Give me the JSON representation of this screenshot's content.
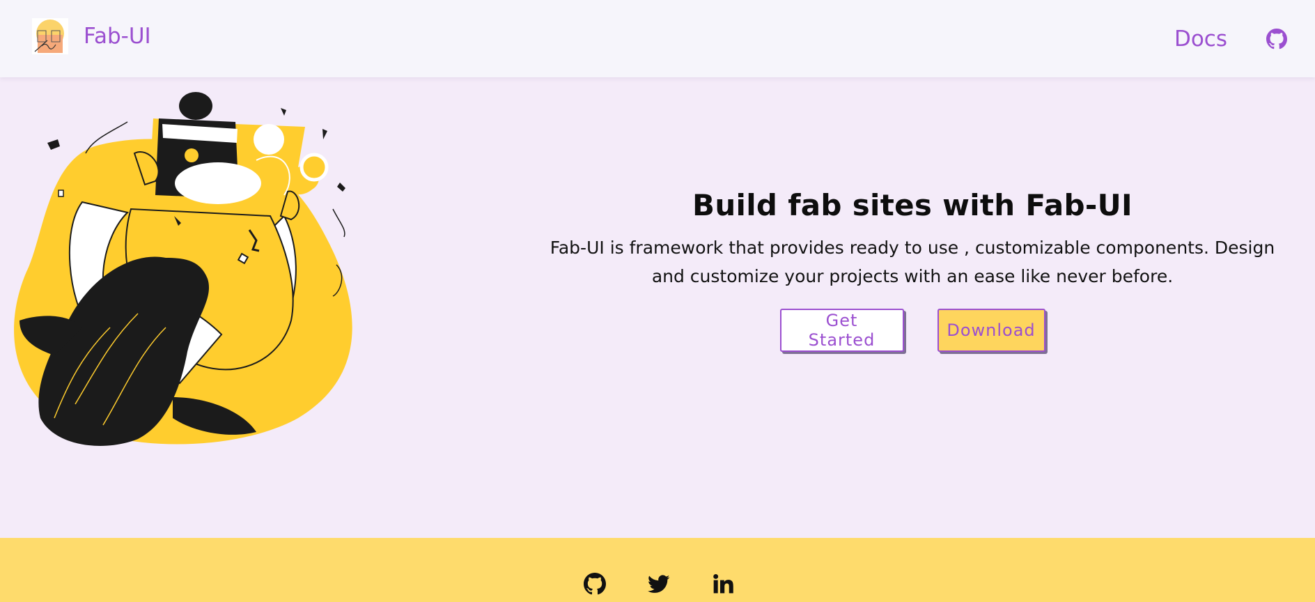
{
  "navbar": {
    "brand_name": "Fab-UI",
    "logo_alt": "logo",
    "docs_label": "Docs",
    "github_icon": "github-icon"
  },
  "hero": {
    "title": "Build fab sites with Fab-UI",
    "description": "Fab-UI is framework that provides ready to use , customizable components. Design and customize your projects with an ease like never before.",
    "get_started_label": "Get Started",
    "download_label": "Download",
    "illustration": "woman-solving-puzzle-illustration"
  },
  "footer": {
    "icons": [
      "github-icon",
      "twitter-icon",
      "linkedin-icon"
    ]
  },
  "colors": {
    "accent": "#9b4fd0",
    "page_bg": "#f4ebf9",
    "navbar_bg": "#f6f5fb",
    "yellow": "#fed55d",
    "footer_bg": "#fedb6c"
  }
}
